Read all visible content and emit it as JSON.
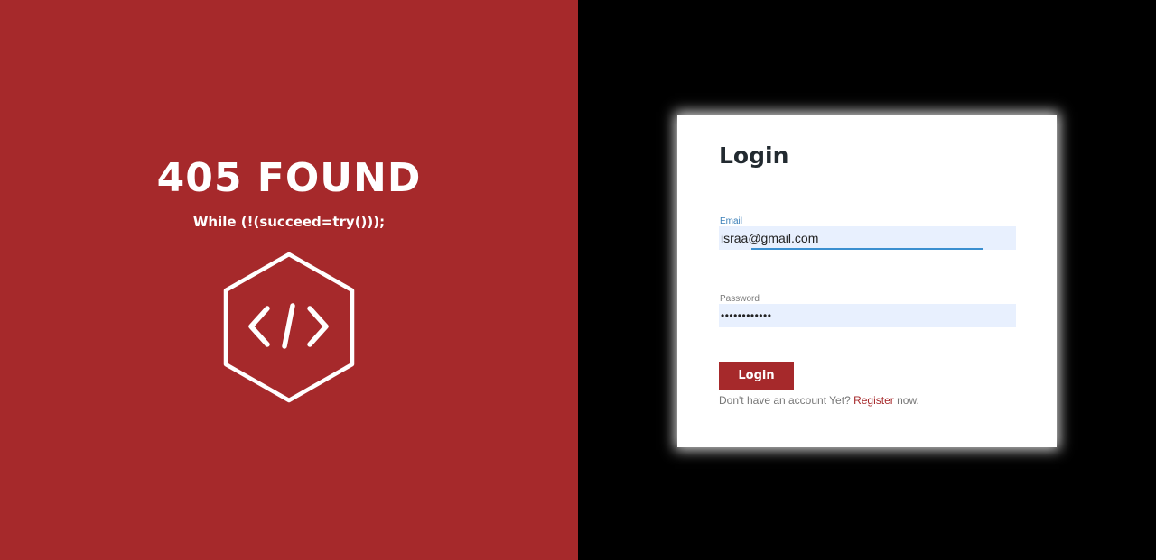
{
  "hero": {
    "headline": "405 FOUND",
    "tagline": "While (!(succeed=try()));",
    "emblem_icon": "code-hexagon-icon"
  },
  "login": {
    "title": "Login",
    "email_label": "Email",
    "email_value": "israa@gmail.com",
    "password_label": "Password",
    "password_value": "••••••••••••",
    "button_label": "Login",
    "register_prefix": "Don't have an account Yet?",
    "register_link": "Register",
    "register_suffix": "now."
  },
  "colors": {
    "brand_red": "#a6292b",
    "right_background": "#000000",
    "autofill_background": "#e8f0fe",
    "focus_accent": "#3b8fd0"
  }
}
